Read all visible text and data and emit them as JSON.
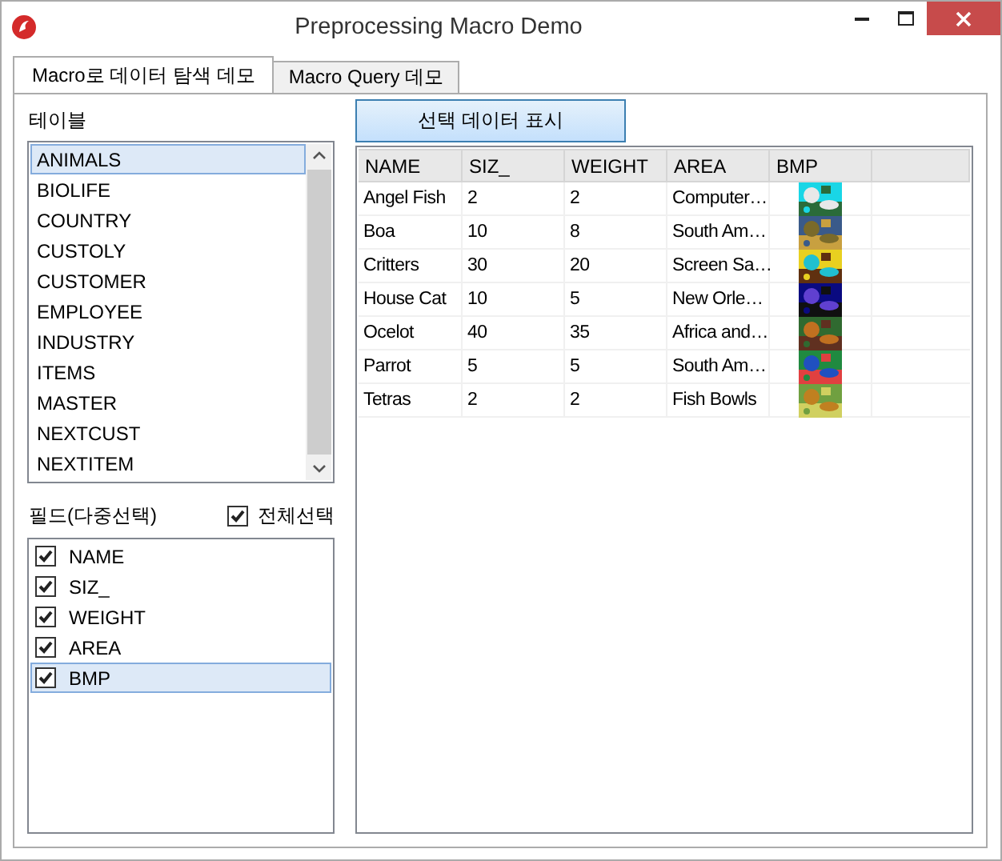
{
  "window": {
    "title": "Preprocessing Macro Demo"
  },
  "tabs": [
    {
      "label": "Macro로 데이터 탐색 데모",
      "selected": true
    },
    {
      "label": "Macro Query 데모",
      "selected": false
    }
  ],
  "tables_label": "테이블",
  "tables": [
    {
      "label": "ANIMALS",
      "selected": true
    },
    {
      "label": "BIOLIFE",
      "selected": false
    },
    {
      "label": "COUNTRY",
      "selected": false
    },
    {
      "label": "CUSTOLY",
      "selected": false
    },
    {
      "label": "CUSTOMER",
      "selected": false
    },
    {
      "label": "EMPLOYEE",
      "selected": false
    },
    {
      "label": "INDUSTRY",
      "selected": false
    },
    {
      "label": "ITEMS",
      "selected": false
    },
    {
      "label": "MASTER",
      "selected": false
    },
    {
      "label": "NEXTCUST",
      "selected": false
    },
    {
      "label": "NEXTITEM",
      "selected": false
    }
  ],
  "fields_label": "필드(다중선택)",
  "select_all": {
    "label": "전체선택",
    "checked": true
  },
  "fields": [
    {
      "label": "NAME",
      "checked": true,
      "selected": false
    },
    {
      "label": "SIZ_",
      "checked": true,
      "selected": false
    },
    {
      "label": "WEIGHT",
      "checked": true,
      "selected": false
    },
    {
      "label": "AREA",
      "checked": true,
      "selected": false
    },
    {
      "label": "BMP",
      "checked": true,
      "selected": true
    }
  ],
  "show_button": "선택 데이터 표시",
  "grid": {
    "columns": [
      "NAME",
      "SIZ_",
      "WEIGHT",
      "AREA",
      "BMP"
    ],
    "rows": [
      [
        "Angel Fish",
        "2",
        "2",
        "Computer…",
        {
          "kind": "picture"
        }
      ],
      [
        "Boa",
        "10",
        "8",
        "South Am…",
        {
          "kind": "picture"
        }
      ],
      [
        "Critters",
        "30",
        "20",
        "Screen Sa…",
        {
          "kind": "picture"
        }
      ],
      [
        "House Cat",
        "10",
        "5",
        "New Orle…",
        {
          "kind": "picture"
        }
      ],
      [
        "Ocelot",
        "40",
        "35",
        "Africa and…",
        {
          "kind": "picture"
        }
      ],
      [
        "Parrot",
        "5",
        "5",
        "South Am…",
        {
          "kind": "picture"
        }
      ],
      [
        "Tetras",
        "2",
        "2",
        "Fish Bowls",
        {
          "kind": "picture"
        }
      ]
    ]
  }
}
